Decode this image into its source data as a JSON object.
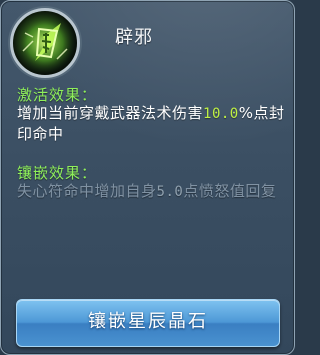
{
  "item": {
    "name": "辟邪",
    "icon": "jade-talisman-icon"
  },
  "activation": {
    "title": "激活效果：",
    "text_before": "增加当前穿戴武器法术伤害",
    "value": "10.0",
    "text_after": "%点封印命中"
  },
  "inlay": {
    "title": "镶嵌效果：",
    "text_before": "失心符命中增加自身",
    "value": "5.0",
    "text_after": "点愤怒值回复"
  },
  "button": {
    "label": "镶嵌星辰晶石"
  },
  "colors": {
    "section_title": "#8ff05a",
    "highlight_value": "#bff043",
    "inactive_text": "#8092a3",
    "button": "#4d98d6"
  }
}
